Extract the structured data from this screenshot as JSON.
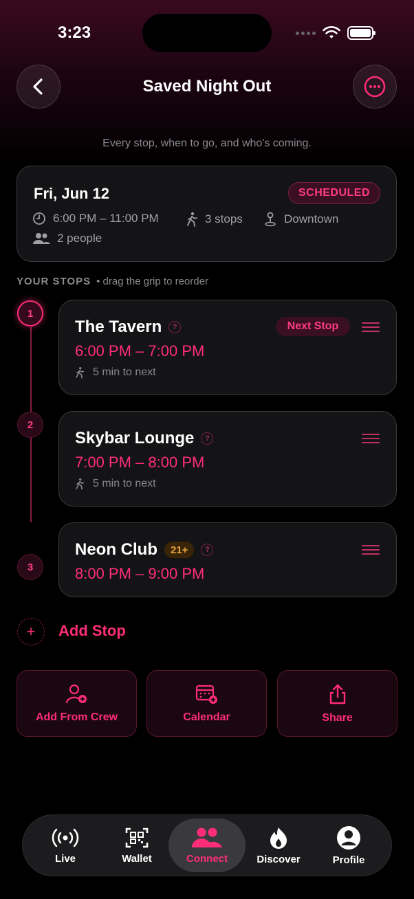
{
  "status": {
    "time": "3:23"
  },
  "header": {
    "title": "Saved Night Out",
    "subtitle": "Every stop, when to go, and who's coming."
  },
  "summary": {
    "date": "Fri, Jun 12",
    "badge": "SCHEDULED",
    "time_range": "6:00 PM – 11:00 PM",
    "stops": "3 stops",
    "location": "Downtown",
    "people": "2 people"
  },
  "section": {
    "title": "YOUR STOPS",
    "hint": "• drag the grip to reorder"
  },
  "stops": [
    {
      "number": "1",
      "name": "The Tavern",
      "time": "6:00 PM – 7:00 PM",
      "walk": "5 min to next",
      "badge": "Next Stop"
    },
    {
      "number": "2",
      "name": "Skybar Lounge",
      "time": "7:00 PM – 8:00 PM",
      "walk": "5 min to next"
    },
    {
      "number": "3",
      "name": "Neon Club",
      "time": "8:00 PM – 9:00 PM",
      "age": "21+"
    }
  ],
  "add_stop": {
    "label": "Add Stop"
  },
  "actions": [
    {
      "label": "Add From Crew"
    },
    {
      "label": "Calendar"
    },
    {
      "label": "Share"
    }
  ],
  "tabs": [
    {
      "label": "Live"
    },
    {
      "label": "Wallet"
    },
    {
      "label": "Connect"
    },
    {
      "label": "Discover"
    },
    {
      "label": "Profile"
    }
  ],
  "colors": {
    "accent": "#ff2d78",
    "background": "#000000",
    "card": "#141416",
    "warning": "#e8a33d"
  }
}
